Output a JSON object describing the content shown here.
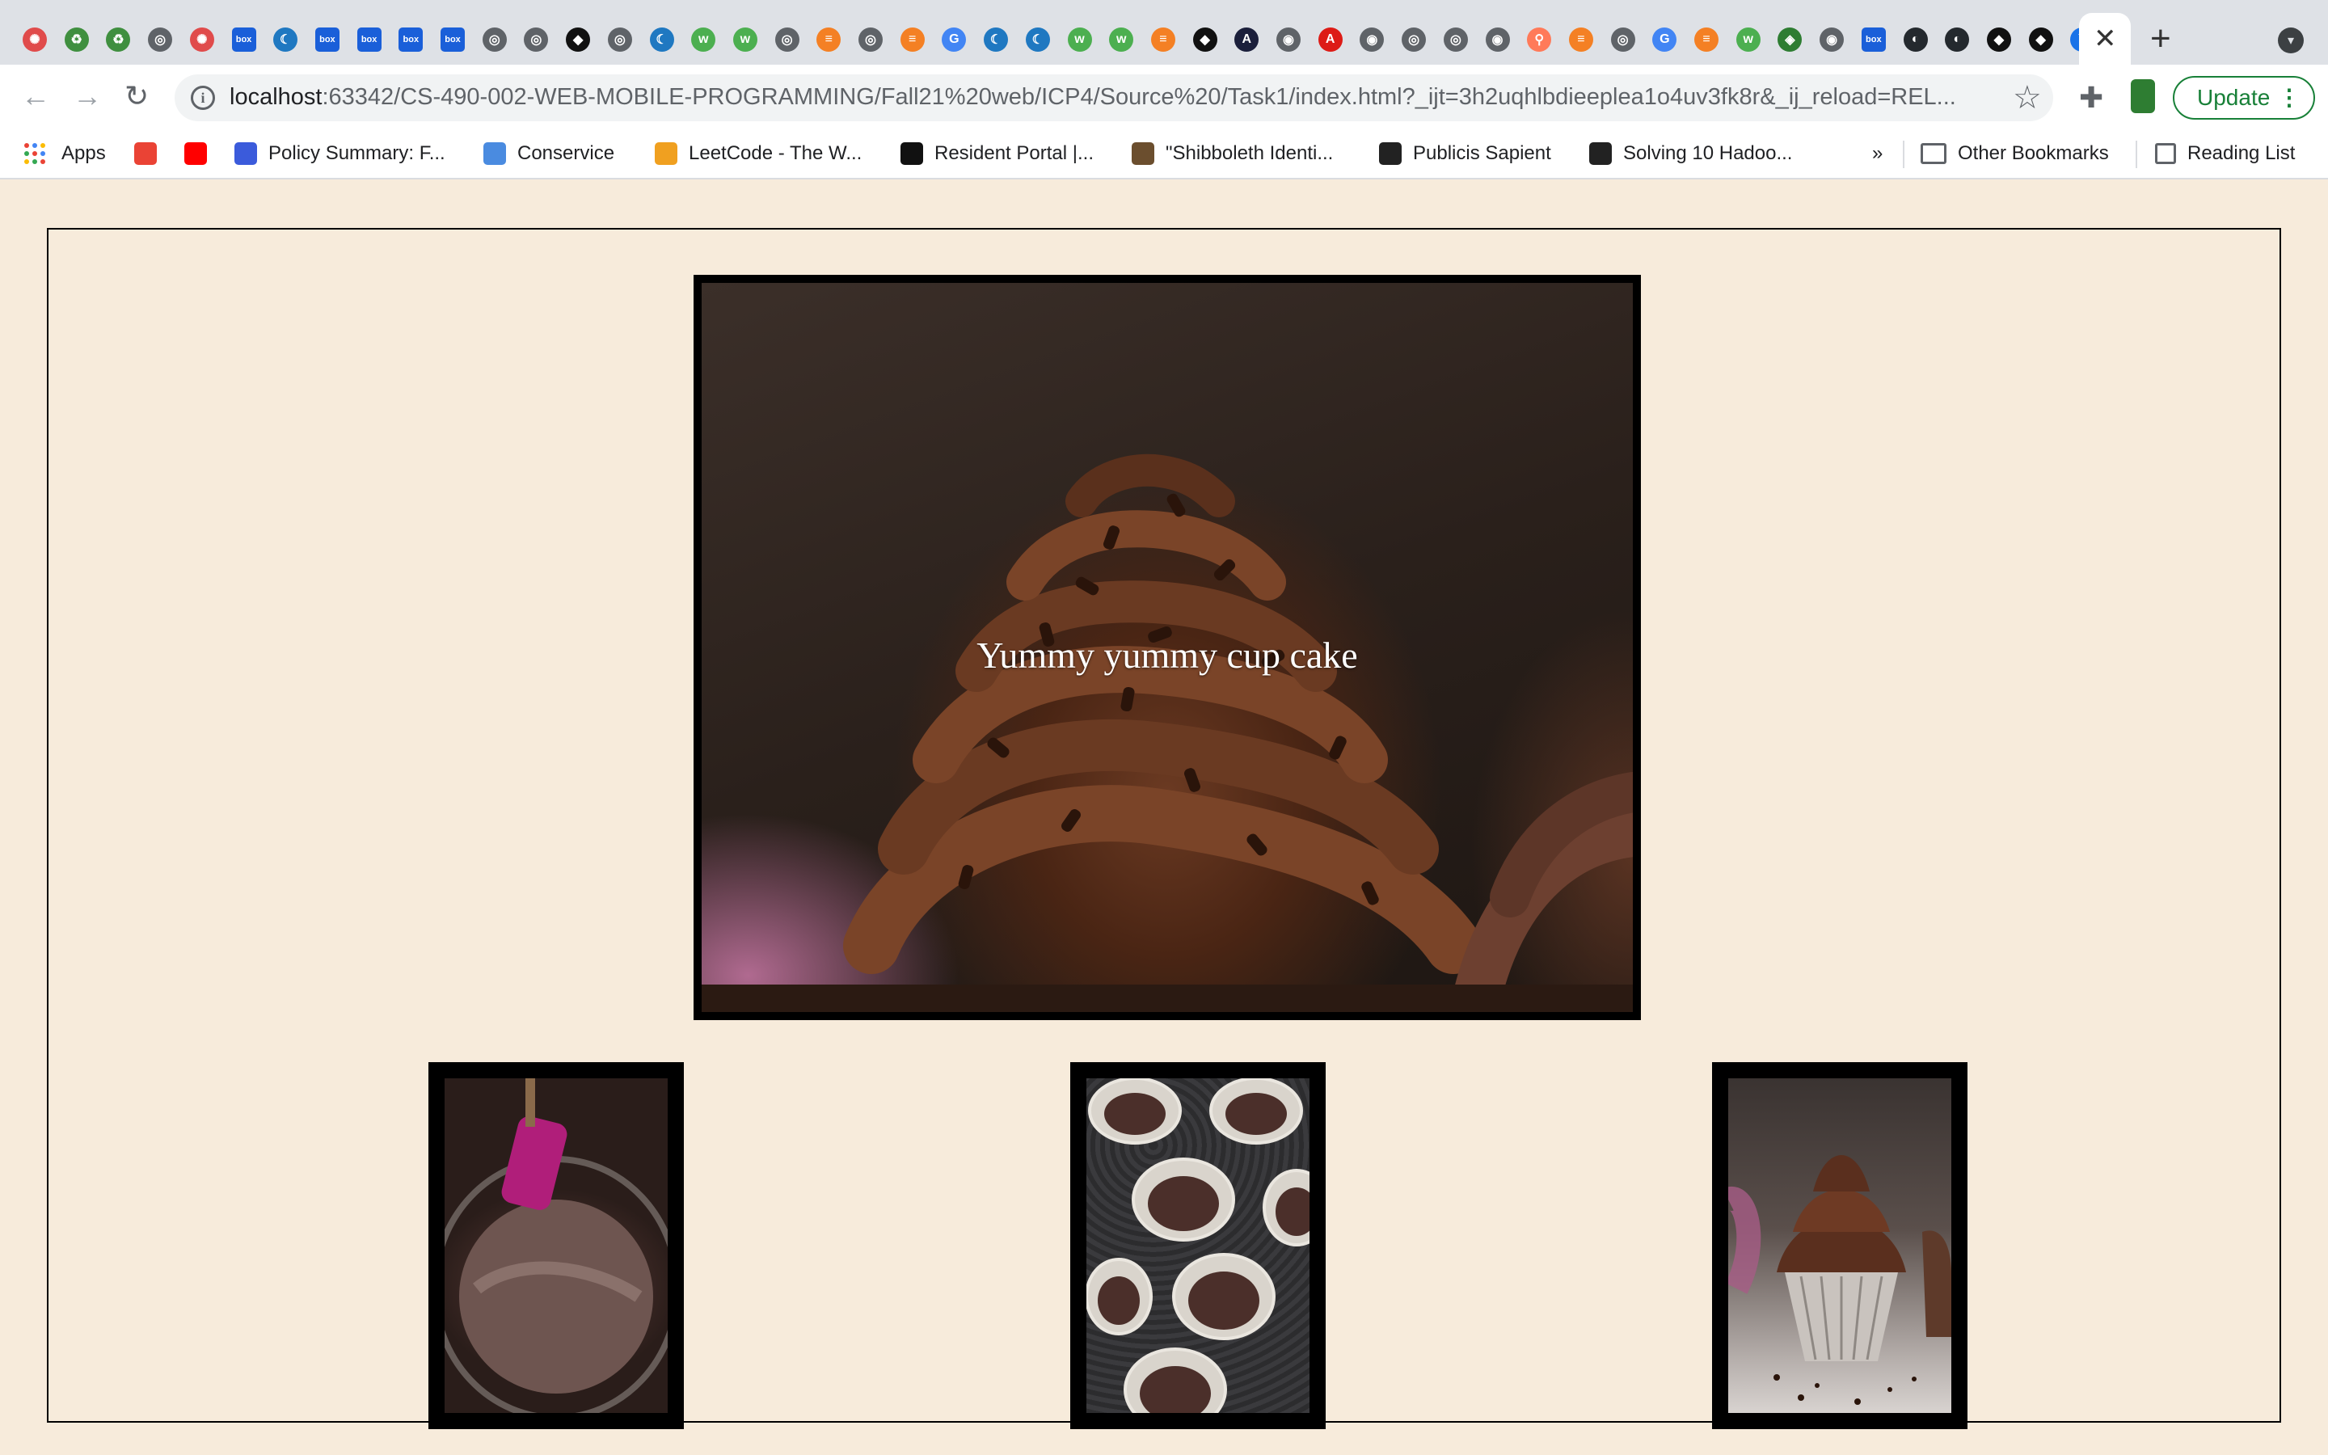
{
  "browser": {
    "tab_icons": [
      {
        "name": "asu-icon",
        "color": "#e04b4b",
        "glyph": "✺"
      },
      {
        "name": "recycle-icon",
        "color": "#3f8f3f",
        "glyph": "♻"
      },
      {
        "name": "recycle-icon",
        "color": "#3f8f3f",
        "glyph": "♻"
      },
      {
        "name": "globe-icon",
        "color": "#5f6368",
        "glyph": "◎"
      },
      {
        "name": "asu-icon",
        "color": "#e04b4b",
        "glyph": "✺"
      },
      {
        "name": "box-icon",
        "color": "#1a5fd9",
        "glyph": "box"
      },
      {
        "name": "jquery-icon",
        "color": "#1f78c1",
        "glyph": "☾"
      },
      {
        "name": "box-icon",
        "color": "#1a5fd9",
        "glyph": "box"
      },
      {
        "name": "box-icon",
        "color": "#1a5fd9",
        "glyph": "box"
      },
      {
        "name": "box-icon",
        "color": "#1a5fd9",
        "glyph": "box"
      },
      {
        "name": "box-icon",
        "color": "#1a5fd9",
        "glyph": "box"
      },
      {
        "name": "globe-icon",
        "color": "#5f6368",
        "glyph": "◎"
      },
      {
        "name": "globe-icon",
        "color": "#5f6368",
        "glyph": "◎"
      },
      {
        "name": "notion-icon",
        "color": "#111111",
        "glyph": "◆"
      },
      {
        "name": "globe-icon",
        "color": "#5f6368",
        "glyph": "◎"
      },
      {
        "name": "jquery-icon",
        "color": "#1f78c1",
        "glyph": "☾"
      },
      {
        "name": "w3schools-icon",
        "color": "#4caf50",
        "glyph": "w"
      },
      {
        "name": "w3schools-icon",
        "color": "#4caf50",
        "glyph": "w"
      },
      {
        "name": "globe-icon",
        "color": "#5f6368",
        "glyph": "◎"
      },
      {
        "name": "stackoverflow-icon",
        "color": "#f48024",
        "glyph": "≡"
      },
      {
        "name": "globe-icon",
        "color": "#5f6368",
        "glyph": "◎"
      },
      {
        "name": "stackoverflow-icon",
        "color": "#f48024",
        "glyph": "≡"
      },
      {
        "name": "google-icon",
        "color": "#4285f4",
        "glyph": "G"
      },
      {
        "name": "jquery-icon",
        "color": "#1f78c1",
        "glyph": "☾"
      },
      {
        "name": "jquery-icon",
        "color": "#1f78c1",
        "glyph": "☾"
      },
      {
        "name": "w3schools-icon",
        "color": "#4caf50",
        "glyph": "w"
      },
      {
        "name": "w3schools-icon",
        "color": "#4caf50",
        "glyph": "w"
      },
      {
        "name": "stackoverflow-icon",
        "color": "#f48024",
        "glyph": "≡"
      },
      {
        "name": "notion-icon",
        "color": "#111111",
        "glyph": "◆"
      },
      {
        "name": "affinity-icon",
        "color": "#1b1f3b",
        "glyph": "A"
      },
      {
        "name": "chrome-icon",
        "color": "#5f6368",
        "glyph": "◉"
      },
      {
        "name": "angular-icon",
        "color": "#dd1b16",
        "glyph": "A"
      },
      {
        "name": "chrome-icon",
        "color": "#5f6368",
        "glyph": "◉"
      },
      {
        "name": "globe-icon",
        "color": "#5f6368",
        "glyph": "◎"
      },
      {
        "name": "globe-icon",
        "color": "#5f6368",
        "glyph": "◎"
      },
      {
        "name": "chrome-icon",
        "color": "#5f6368",
        "glyph": "◉"
      },
      {
        "name": "hubspot-icon",
        "color": "#ff7a59",
        "glyph": "⚲"
      },
      {
        "name": "stackoverflow-icon",
        "color": "#f48024",
        "glyph": "≡"
      },
      {
        "name": "globe-icon",
        "color": "#5f6368",
        "glyph": "◎"
      },
      {
        "name": "google-icon",
        "color": "#4285f4",
        "glyph": "G"
      },
      {
        "name": "stackoverflow-icon",
        "color": "#f48024",
        "glyph": "≡"
      },
      {
        "name": "w3schools-icon",
        "color": "#4caf50",
        "glyph": "w"
      },
      {
        "name": "diamond-icon",
        "color": "#2e7d32",
        "glyph": "◈"
      },
      {
        "name": "chrome-icon",
        "color": "#5f6368",
        "glyph": "◉"
      },
      {
        "name": "box-icon",
        "color": "#1a5fd9",
        "glyph": "box"
      },
      {
        "name": "github-icon",
        "color": "#24292e",
        "glyph": "◐"
      },
      {
        "name": "github-icon",
        "color": "#24292e",
        "glyph": "◐"
      },
      {
        "name": "notion-icon",
        "color": "#111111",
        "glyph": "◆"
      },
      {
        "name": "notion-icon",
        "color": "#111111",
        "glyph": "◆"
      },
      {
        "name": "yahoo-icon",
        "color": "#1a73e8",
        "glyph": "Y"
      }
    ],
    "tab_close_glyph": "✕",
    "new_tab_glyph": "+",
    "tab_search_glyph": "▾",
    "back_glyph": "←",
    "forward_glyph": "→",
    "reload_glyph": "↻",
    "info_glyph": "i",
    "url_host": "localhost",
    "url_rest": ":63342/CS-490-002-WEB-MOBILE-PROGRAMMING/Fall21%20web/ICP4/Source%20/Task1/index.html?_ijt=3h2uqhlbdieeplea1o4uv3fk8r&_ij_reload=REL...",
    "star_glyph": "☆",
    "extensions_glyph": "✚",
    "update_label": "Update",
    "menu_glyph": "⋮"
  },
  "bookmarks": {
    "apps_label": "Apps",
    "items": [
      {
        "label": "",
        "name": "gmail-icon",
        "color": "#ea4335"
      },
      {
        "label": "",
        "name": "youtube-icon",
        "color": "#ff0000"
      },
      {
        "label": "Policy Summary: F...",
        "name": "policy-icon",
        "color": "#3b5bdb"
      },
      {
        "label": "Conservice",
        "name": "house-icon",
        "color": "#4a8be0"
      },
      {
        "label": "LeetCode - The W...",
        "name": "leetcode-icon",
        "color": "#f0a020"
      },
      {
        "label": "Resident Portal |...",
        "name": "resident-portal-icon",
        "color": "#111111"
      },
      {
        "label": "\"Shibboleth Identi...",
        "name": "shibboleth-icon",
        "color": "#6b4e2e"
      },
      {
        "label": "Publicis Sapient",
        "name": "publicis-icon",
        "color": "#222222"
      },
      {
        "label": "Solving 10 Hadoo...",
        "name": "publicis-icon",
        "color": "#222222"
      }
    ],
    "more_glyph": "»",
    "other_label": "Other Bookmarks",
    "reading_label": "Reading List"
  },
  "page": {
    "hero_caption": "Yummy yummy cup cake",
    "background": "#f7ebdb",
    "thumbnails": [
      {
        "name": "batter-mixing-image"
      },
      {
        "name": "cupcake-liners-tray-image"
      },
      {
        "name": "frosted-cupcake-image"
      }
    ]
  }
}
